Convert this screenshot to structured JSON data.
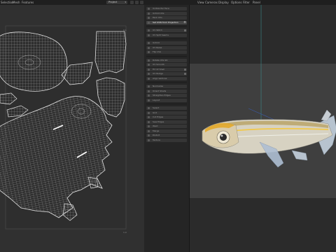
{
  "menubar": {
    "left_items": [
      "Selection",
      "Mesh",
      "Features"
    ],
    "project_dropdown": "Project",
    "right_items": [
      "View",
      "Cameras",
      "Display",
      "Options",
      "Filter",
      "Panel"
    ]
  },
  "uv_editor": {
    "corner_labels": [
      "0,1",
      "1,0"
    ]
  },
  "tool_menu": {
    "items": [
      {
        "label": "Unitize Per Face"
      },
      {
        "label": "Unfold UVs"
      },
      {
        "label": "Pack UVs"
      },
      {
        "label": "Set UVW from Projection",
        "highlighted": true
      },
      {
        "label": "UV Stitch"
      },
      {
        "label": "UV Split Seams"
      },
      {
        "label": "Unfold"
      },
      {
        "label": "UV Relax"
      },
      {
        "label": "Flip UVs"
      },
      {
        "label": "Rotate UVs 90"
      },
      {
        "label": "UV Smooth"
      },
      {
        "label": "Fit UV Shell"
      },
      {
        "label": "UV Nudge"
      },
      {
        "label": "Align Vertices"
      },
      {
        "label": "Normalize"
      },
      {
        "label": "Orient Shells"
      },
      {
        "label": "Straighten Edges"
      },
      {
        "label": "Layout"
      },
      {
        "label": "Select"
      },
      {
        "label": "Grid"
      },
      {
        "label": "Cut Edges"
      },
      {
        "label": "Sew Edges"
      },
      {
        "label": "Weld"
      },
      {
        "label": "Merge"
      },
      {
        "label": "Distort"
      },
      {
        "label": "Texture"
      }
    ]
  }
}
